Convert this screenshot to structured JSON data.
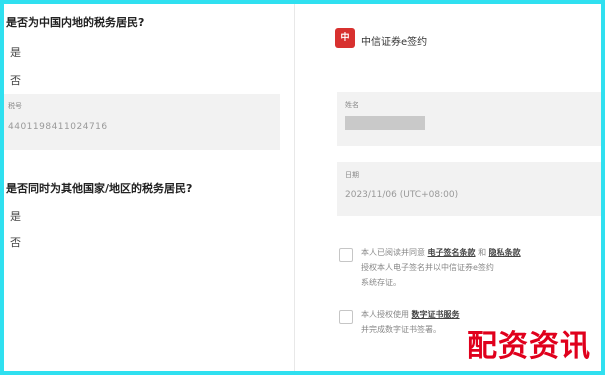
{
  "left": {
    "q1": "是否为中国内地的税务居民?",
    "q1_options": [
      "是",
      "否"
    ],
    "id_label": "税号",
    "id_value": "4401198411024716",
    "q2": "是否同时为其他国家/地区的税务居民?",
    "q2_options": [
      "是",
      "否"
    ]
  },
  "right": {
    "logo_mark": "中",
    "logo_text": "中信证券e签约",
    "name_label": "姓名",
    "date_label": "日期",
    "date_value": "2023/11/06 (UTC+08:00)",
    "term1_prefix": "本人已阅读并同意",
    "term1_link1": "电子签名条款",
    "term1_mid": "和",
    "term1_link2": "隐私条款",
    "term1_line2": "授权本人电子签名并以中信证券e签约",
    "term1_line3": "系统存证。",
    "term2_prefix": "本人授权使用",
    "term2_link": "数字证书服务",
    "term2_line2": "并完成数字证书签署。"
  },
  "watermark": "配资资讯",
  "colors": {
    "frame": "#2fe0f0",
    "brand": "#d8312f",
    "watermark": "#e0001c"
  }
}
